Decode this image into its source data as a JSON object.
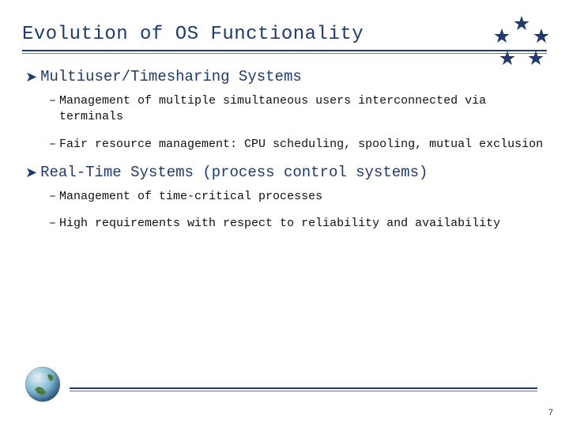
{
  "title": "Evolution of OS Functionality",
  "sections": [
    {
      "heading": "Multiuser/Timesharing Systems",
      "items": [
        "Management of multiple simultaneous users interconnected via terminals",
        "Fair resource management: CPU scheduling, spooling, mutual exclusion"
      ]
    },
    {
      "heading": "Real-Time Systems (process control systems)",
      "items": [
        "Management of time-critical processes",
        "High requirements with respect to reliability and availability"
      ]
    }
  ],
  "page_number": "7"
}
